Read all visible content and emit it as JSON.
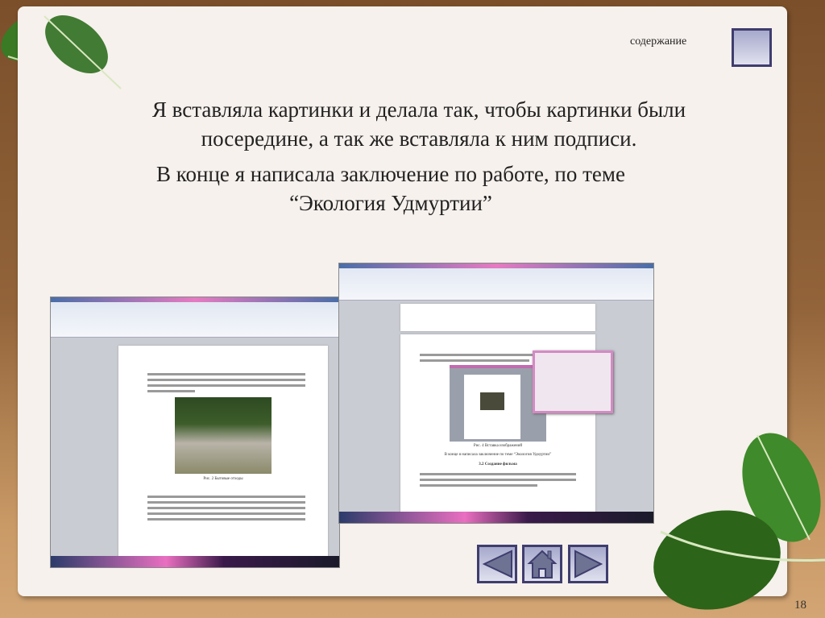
{
  "slide": {
    "contents_link": "содержание",
    "paragraphs": [
      "Я вставляла картинки и делала так, чтобы картинки были посередине, а так же вставляла к ним подписи.",
      "В конце я написала заключение по работе, по теме “Экология Удмуртии”"
    ],
    "page_number": "18"
  },
  "screenshot_left": {
    "caption": "Рис. 2 Бытовые отходы"
  },
  "screenshot_right": {
    "caption": "Рис. 4 Вставка изображений",
    "conclusion_line": "В конце я написала заключение по теме “Экология Удмуртии”",
    "heading": "3.2 Создание фильма"
  },
  "nav": {
    "prev_icon": "triangle-left",
    "home_icon": "house",
    "next_icon": "triangle-right"
  },
  "colors": {
    "button_border": "#3f3d6e",
    "paper": "#f6f1ed",
    "leaf": "#2e6a1c"
  }
}
